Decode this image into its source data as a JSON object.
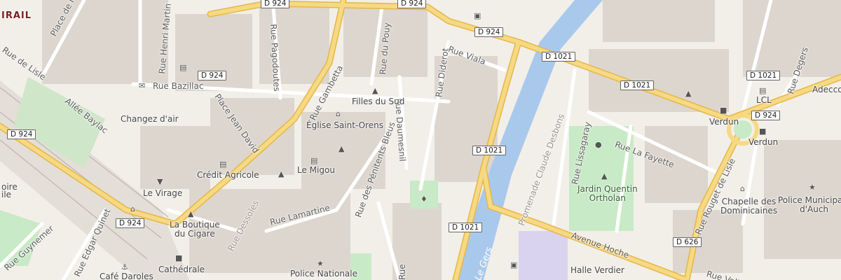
{
  "map": {
    "district_label": "IRAIL",
    "water_label": "Le Gers",
    "shields": {
      "d924_top": "D 924",
      "d924_top2": "D 924",
      "d924_mid": "D 924",
      "d924_left": "D 924",
      "d924_bottom": "D 924",
      "d924_right": "D 924",
      "d1021_a": "D 1021",
      "d1021_b": "D 1021",
      "d1021_c": "D 1021",
      "d1021_d": "D 1021",
      "d1021_e": "D 1021",
      "d626": "D 626"
    },
    "streets": {
      "place_ancien_foirail": "Place de l'Ancien Fo",
      "rue_henri_martin": "Rue Henri Martin",
      "rue_pagodoutes": "Rue Pagodoutes",
      "rue_gambetta": "Rue Gambetta",
      "place_jean_david": "Place Jean David",
      "rue_bazillac": "Rue Bazillac",
      "rue_du_pouy": "Rue du Pouy",
      "rue_viala": "Rue Viala",
      "rue_diderot": "Rue Diderot",
      "rue_daumesnil": "Rue Daumesnil",
      "rue_des_penitents_bleus": "Rue des Pénitents Bleus",
      "rue_lamartine": "Rue Lamartine",
      "rue_dessoles": "Rue Dessoles",
      "allee_baylac": "Allée Baylac",
      "rue_de_lisle": "Rue de Lisle",
      "rue_edgar_quinet": "Rue Edgar Quinet",
      "rue_guynemer": "Rue Guynemer",
      "promenade_desbons": "Promenade Claude Desbons",
      "rue_lissagaray": "Rue Lissagaray",
      "rue_la_fayette": "Rue La Fayette",
      "rue_rouget_de_lisle": "Rue Rouget de Lisle",
      "rue_degers": "Rue Degers",
      "avenue_hoche": "Avenue Hoche",
      "rue_voltaire": "Rue Volta",
      "rue_bottom_mid": "Rue"
    },
    "pois": {
      "filles_du_sud": "Filles du Sud",
      "eglise_saint_orens": "Église Saint-Orens",
      "changez_dair": "Changez d'air",
      "credit_agricole": "Crédit Agricole",
      "le_migou": "Le Migou",
      "le_virage": "Le Virage",
      "la_boutique_du_cigare": "La Boutique\ndu Cigare",
      "cathedrale": "Cathédrale",
      "cafe_daroles": "Café Daroles",
      "police_nationale": "Police Nationale",
      "jardin_quentin_ortholan": "Jardin Quentin\nOrtholan",
      "chapelle_des_dominicaines": "Chapelle des\nDominicaines",
      "police_municipale": "Police Municipale\nd'Auch",
      "halle_verdier": "Halle Verdier",
      "lcl": "LCL",
      "verdun_1": "Verdun",
      "verdun_2": "Verdun",
      "adecco": "Adecco",
      "oire": "oire",
      "ile": "ile"
    },
    "colors": {
      "background": "#f2efe9",
      "building": "#ddd6ce",
      "water": "#a9c9ec",
      "park": "#c8eac6",
      "primary_road": "#f4cf72",
      "minor_road": "#ffffff",
      "rail": "#cfcac3"
    }
  }
}
